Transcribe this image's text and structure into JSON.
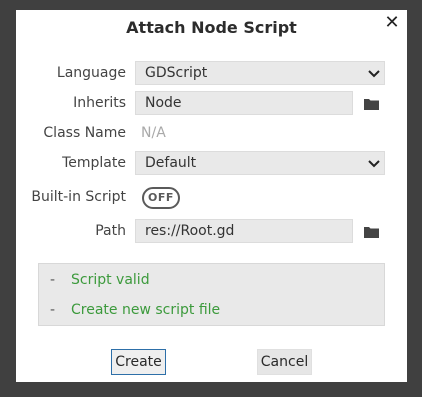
{
  "dialog": {
    "title": "Attach Node Script",
    "close_icon": "close-icon"
  },
  "form": {
    "language": {
      "label": "Language",
      "value": "GDScript"
    },
    "inherits": {
      "label": "Inherits",
      "value": "Node"
    },
    "class_name": {
      "label": "Class Name",
      "value": "N/A"
    },
    "template": {
      "label": "Template",
      "value": "Default"
    },
    "builtin": {
      "label": "Built-in Script",
      "toggle_text": "OFF"
    },
    "path": {
      "label": "Path",
      "value": "res://Root.gd"
    }
  },
  "status": {
    "dash": "-",
    "items": [
      "Script valid",
      "Create new script file"
    ]
  },
  "buttons": {
    "create": "Create",
    "cancel": "Cancel"
  },
  "colors": {
    "status_green": "#3c9a3c",
    "focus_border": "#2d6fa8"
  }
}
